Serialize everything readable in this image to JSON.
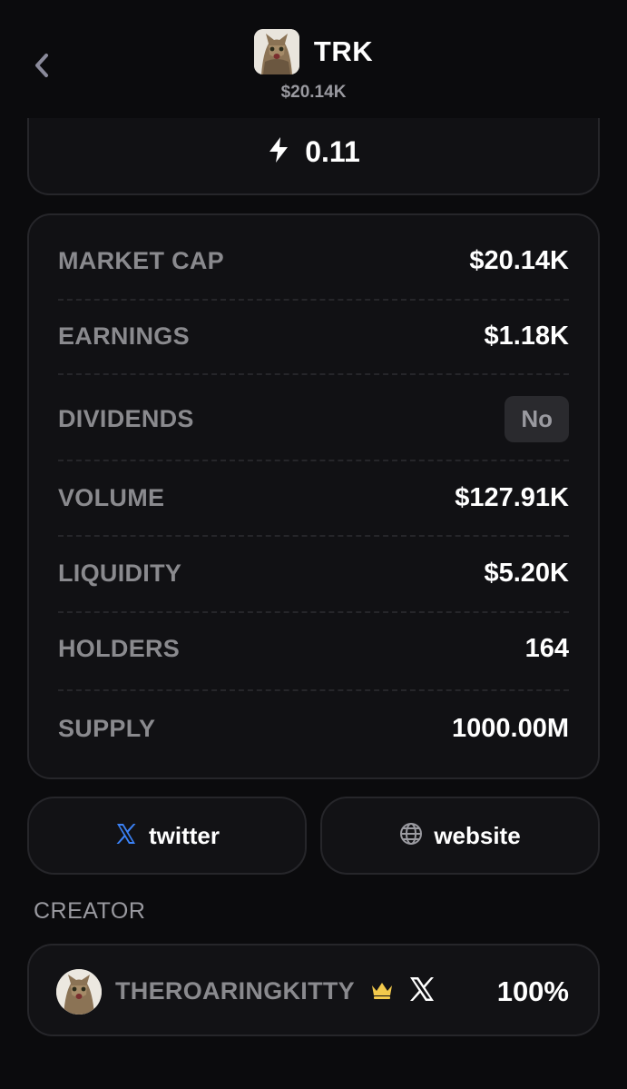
{
  "header": {
    "symbol": "TRK",
    "price": "$20.14K",
    "back_icon": "chevron-left-icon",
    "avatar_icon": "cat-avatar-icon"
  },
  "energy": {
    "icon": "lightning-bolt-icon",
    "value": "0.11"
  },
  "stats": {
    "market_cap": {
      "label": "MARKET CAP",
      "value": "$20.14K"
    },
    "earnings": {
      "label": "EARNINGS",
      "value": "$1.18K"
    },
    "dividends": {
      "label": "DIVIDENDS",
      "value": "No"
    },
    "volume": {
      "label": "VOLUME",
      "value": "$127.91K"
    },
    "liquidity": {
      "label": "LIQUIDITY",
      "value": "$5.20K"
    },
    "holders": {
      "label": "HOLDERS",
      "value": "164"
    },
    "supply": {
      "label": "SUPPLY",
      "value": "1000.00M"
    }
  },
  "links": {
    "twitter": {
      "label": "twitter",
      "icon": "x-logo-icon"
    },
    "website": {
      "label": "website",
      "icon": "globe-icon"
    }
  },
  "creator": {
    "section_title": "CREATOR",
    "name": "THEROARINGKITTY",
    "percent": "100%",
    "crown_icon": "crown-icon",
    "x_icon": "x-logo-icon"
  },
  "colors": {
    "background": "#0b0b0d",
    "card": "#111114",
    "border": "#26262a",
    "muted_text": "#8a8a8e",
    "twitter_blue": "#3b82f6",
    "crown_gold": "#f2c94c"
  }
}
